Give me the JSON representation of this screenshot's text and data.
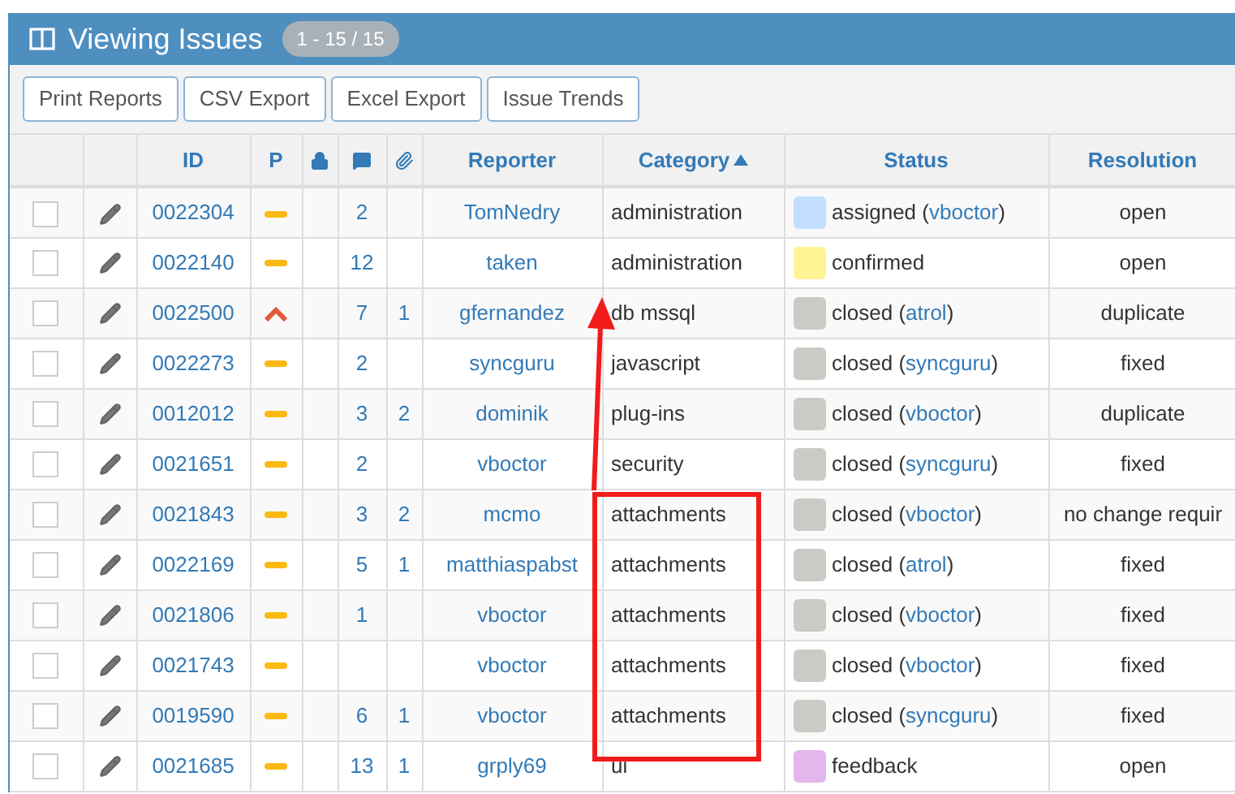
{
  "header": {
    "title": "Viewing Issues",
    "count": "1 - 15 / 15"
  },
  "toolbar": [
    "Print Reports",
    "CSV Export",
    "Excel Export",
    "Issue Trends"
  ],
  "columns": [
    {
      "label": "ID",
      "sorted": false
    },
    {
      "label": "P",
      "sorted": false
    },
    {
      "label": "Reporter",
      "sorted": false
    },
    {
      "label": "Category",
      "sorted": true
    },
    {
      "label": "Status",
      "sorted": false
    },
    {
      "label": "Resolution",
      "sorted": false
    }
  ],
  "rows": [
    {
      "checked": false,
      "id": "0022304",
      "priority": {
        "kind": "normal"
      },
      "notes": "2",
      "reporter": "TomNedry",
      "category": "administration",
      "status": "assigned (",
      "handler": "vboctor",
      "status_end": ")",
      "color": "#c2dfff",
      "resolution": "open"
    },
    {
      "checked": false,
      "id": "0022140",
      "priority": {
        "kind": "normal"
      },
      "notes": "12",
      "reporter": "taken",
      "category": "administration",
      "status": "confirmed",
      "color": "#fff494",
      "resolution": "open"
    },
    {
      "checked": false,
      "id": "0022500",
      "priority": {
        "kind": "high"
      },
      "notes": "7",
      "attachments": "1",
      "reporter": "gfernandez",
      "category": "db mssql",
      "status": "closed (",
      "handler": "atrol",
      "status_end": ")",
      "color": "#c9ccc4",
      "resolution": "duplicate"
    },
    {
      "checked": false,
      "id": "0022273",
      "priority": {
        "kind": "normal"
      },
      "notes": "2",
      "reporter": "syncguru",
      "category": "javascript",
      "status": "closed (",
      "handler": "syncguru",
      "status_end": ")",
      "color": "#c9ccc4",
      "resolution": "fixed"
    },
    {
      "checked": false,
      "id": "0012012",
      "priority": {
        "kind": "normal"
      },
      "notes": "3",
      "attachments": "2",
      "reporter": "dominik",
      "category": "plug-ins",
      "status": "closed (",
      "handler": "vboctor",
      "status_end": ")",
      "color": "#c9ccc4",
      "resolution": "duplicate"
    },
    {
      "checked": false,
      "id": "0021651",
      "priority": {
        "kind": "normal"
      },
      "notes": "2",
      "reporter": "vboctor",
      "category": "security",
      "status": "closed (",
      "handler": "syncguru",
      "status_end": ")",
      "color": "#c9ccc4",
      "resolution": "fixed"
    },
    {
      "checked": false,
      "id": "0021843",
      "priority": {
        "kind": "normal"
      },
      "notes": "3",
      "attachments": "2",
      "reporter": "mcmo",
      "category": "attachments",
      "status": "closed (",
      "handler": "vboctor",
      "status_end": ")",
      "color": "#c9ccc4",
      "resolution": "no change requir"
    },
    {
      "checked": false,
      "id": "0022169",
      "priority": {
        "kind": "normal"
      },
      "notes": "5",
      "attachments": "1",
      "reporter": "matthiaspabst",
      "category": "attachments",
      "status": "closed (",
      "handler": "atrol",
      "status_end": ")",
      "color": "#c9ccc4",
      "resolution": "fixed"
    },
    {
      "checked": false,
      "id": "0021806",
      "priority": {
        "kind": "normal"
      },
      "notes": "1",
      "reporter": "vboctor",
      "category": "attachments",
      "status": "closed (",
      "handler": "vboctor",
      "status_end": ")",
      "color": "#c9ccc4",
      "resolution": "fixed"
    },
    {
      "checked": false,
      "id": "0021743",
      "priority": {
        "kind": "normal"
      },
      "reporter": "vboctor",
      "category": "attachments",
      "status": "closed (",
      "handler": "vboctor",
      "status_end": ")",
      "color": "#c9ccc4",
      "resolution": "fixed"
    },
    {
      "checked": false,
      "id": "0019590",
      "priority": {
        "kind": "normal"
      },
      "notes": "6",
      "attachments": "1",
      "reporter": "vboctor",
      "category": "attachments",
      "status": "closed (",
      "handler": "syncguru",
      "status_end": ")",
      "color": "#c9ccc4",
      "resolution": "fixed"
    },
    {
      "checked": false,
      "id": "0021685",
      "priority": {
        "kind": "normal"
      },
      "notes": "13",
      "attachments": "1",
      "reporter": "grply69",
      "category": "ui",
      "status": "feedback",
      "color": "#e3b7eb",
      "resolution": "open"
    }
  ]
}
